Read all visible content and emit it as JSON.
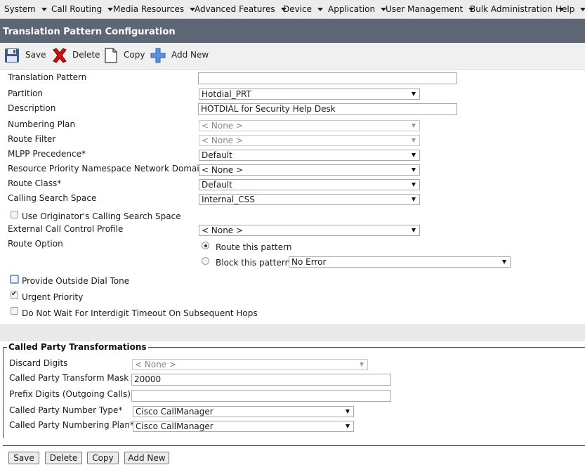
{
  "menu": {
    "items": [
      "System",
      "Call Routing",
      "Media Resources",
      "Advanced Features",
      "Device",
      "Application",
      "User Management",
      "Bulk Administration",
      "Help"
    ]
  },
  "title": "Translation Pattern Configuration",
  "toolbar": {
    "save": "Save",
    "delete": "Delete",
    "copy": "Copy",
    "add_new": "Add New"
  },
  "form": {
    "translation_pattern": {
      "label": "Translation Pattern",
      "value": ""
    },
    "partition": {
      "label": "Partition",
      "value": "Hotdial_PRT"
    },
    "description": {
      "label": "Description",
      "value": "HOTDIAL for Security Help Desk"
    },
    "numbering_plan": {
      "label": "Numbering Plan",
      "value": "< None >"
    },
    "route_filter": {
      "label": "Route Filter",
      "value": "< None >"
    },
    "mlpp_precedence": {
      "label": "MLPP Precedence",
      "value": "Default"
    },
    "resource_priority": {
      "label": "Resource Priority Namespace Network Domain",
      "value": "< None >"
    },
    "route_class": {
      "label": "Route Class",
      "value": "Default"
    },
    "calling_search_space": {
      "label": "Calling Search Space",
      "value": "Internal_CSS"
    },
    "use_originator_css": {
      "label": "Use Originator's Calling Search Space",
      "checked": false
    },
    "external_call_control": {
      "label": "External Call Control Profile",
      "value": "< None >"
    },
    "route_option": {
      "label": "Route Option",
      "route_this_pattern": "Route this pattern",
      "block_this_pattern": "Block this pattern",
      "block_reason": "No Error",
      "selected": "route"
    },
    "provide_outside_dial_tone": {
      "label": "Provide Outside Dial Tone",
      "checked": false
    },
    "urgent_priority": {
      "label": "Urgent Priority",
      "checked": true
    },
    "do_not_wait": {
      "label": "Do Not Wait For Interdigit Timeout On Subsequent Hops",
      "checked": false
    },
    "required_marker": "*"
  },
  "called_party": {
    "legend": "Called Party Transformations",
    "discard_digits": {
      "label": "Discard Digits",
      "value": "< None >"
    },
    "transform_mask": {
      "label": "Called Party Transform Mask",
      "value": "20000"
    },
    "prefix_digits": {
      "label": "Prefix Digits (Outgoing Calls)",
      "value": ""
    },
    "number_type": {
      "label": "Called Party Number Type",
      "value": "Cisco CallManager"
    },
    "numbering_plan": {
      "label": "Called Party Numbering Plan",
      "value": "Cisco CallManager"
    }
  },
  "bottom_buttons": {
    "save": "Save",
    "delete": "Delete",
    "copy": "Copy",
    "add_new": "Add New"
  },
  "colors": {
    "title_bar": "#5c6675",
    "menu_bar": "#ececec",
    "toolbar": "#f0f0f0",
    "delete_icon": "#cc1111",
    "add_icon": "#3a7bd5"
  }
}
